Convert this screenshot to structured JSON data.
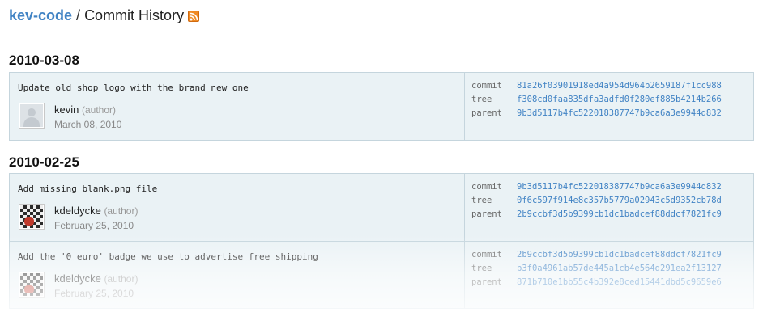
{
  "header": {
    "repo": "kev-code",
    "separator": "/",
    "title": "Commit History",
    "rss_icon": "rss-icon"
  },
  "groups": [
    {
      "date": "2010-03-08",
      "commits": [
        {
          "message": "Update old shop logo with the brand new one",
          "author": "kevin",
          "role": "(author)",
          "date": "March 08, 2010",
          "avatar": "default-avatar-icon",
          "commit_label": "commit",
          "commit": "81a26f03901918ed4a954d964b2659187f1cc988",
          "tree_label": "tree",
          "tree": "f308cd0faa835dfa3adfd0f280ef885b4214b266",
          "parent_label": "parent",
          "parent": "9b3d5117b4fc52201838774 7b9ca6a3e9944d832"
        }
      ]
    },
    {
      "date": "2010-02-25",
      "commits": [
        {
          "message": "Add missing blank.png file",
          "author": "kdeldycke",
          "role": "(author)",
          "date": "February 25, 2010",
          "avatar": "pattern-avatar-icon",
          "commit_label": "commit",
          "commit": "9b3d5117b4fc522018387747b9ca6a3e9944d832",
          "tree_label": "tree",
          "tree": "0f6c597f914e8c357b5779a02943c5d9352cb78d",
          "parent_label": "parent",
          "parent": "2b9ccbf3d5b9399cb1dc1badcef88ddcf7821fc9"
        },
        {
          "message": "Add the '0 euro' badge we use to advertise free shipping",
          "author": "kdeldycke",
          "role": "(author)",
          "date": "February 25, 2010",
          "avatar": "pattern-avatar-icon",
          "commit_label": "commit",
          "commit": "2b9ccbf3d5b9399cb1dc1badcef88ddcf7821fc9",
          "tree_label": "tree",
          "tree": "b3f0a4961ab57de445a1cb4e564d291ea2f13127",
          "parent_label": "parent",
          "parent": "871b710e1bb55c4b392e8ced15441dbd5c9659e6"
        }
      ]
    }
  ]
}
